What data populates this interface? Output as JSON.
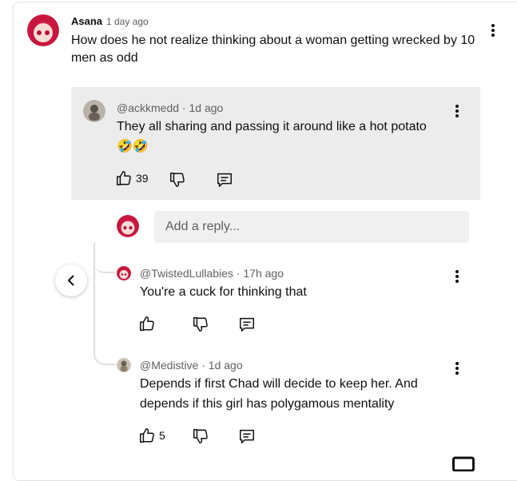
{
  "top_comment": {
    "author": "Asana",
    "time": "1 day ago",
    "text": "How does he not realize thinking about a woman getting wrecked by 10 men as odd",
    "avatar_icon": "anime-girl-avatar"
  },
  "replies": [
    {
      "handle": "@ackkmedd",
      "time": "1d ago",
      "text_line1": "They all sharing and passing it around like a hot potato",
      "text_line2": "🤣🤣",
      "likes": "39",
      "highlighted": true
    },
    {
      "handle": "@TwistedLullabies",
      "time": "17h ago",
      "text_line1": "You're a cuck for thinking that",
      "likes": ""
    },
    {
      "handle": "@Medistive",
      "time": "1d ago",
      "text_line1": "Depends if first Chad will decide to keep her. And",
      "text_line2": "depends if this girl has polygamous mentality",
      "likes": "5"
    }
  ],
  "reply_box": {
    "placeholder": "Add a reply..."
  },
  "separators": {
    "dot": "·"
  },
  "colors": {
    "highlight": "#ececec",
    "text": "#0f0f0f",
    "muted": "#606060"
  }
}
